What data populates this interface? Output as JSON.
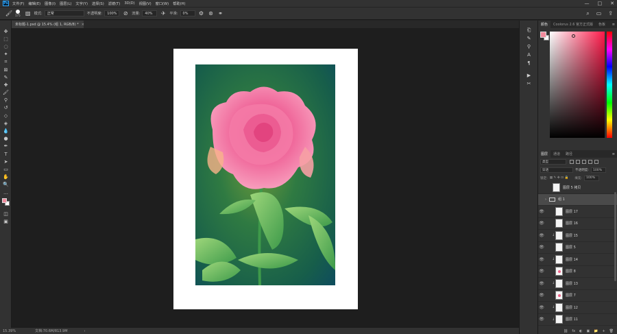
{
  "app": {
    "logo": "Ps"
  },
  "menu": [
    "文件(F)",
    "编辑(E)",
    "图像(I)",
    "图层(L)",
    "文字(Y)",
    "选择(S)",
    "滤镜(T)",
    "3D(D)",
    "视图(V)",
    "窗口(W)",
    "帮助(H)"
  ],
  "window_controls": [
    "—",
    "□",
    "✕"
  ],
  "options": {
    "brush_size": "175",
    "mode_label": "模式:",
    "mode_value": "正常",
    "opacity_label": "不透明度:",
    "opacity_value": "100%",
    "flow_label": "流量:",
    "flow_value": "40%",
    "smoothing_label": "平滑:",
    "smoothing_value": "0%"
  },
  "document": {
    "tab_title": "未标题-1.psd @ 15.4% (组 1, RGB/8) *",
    "tab_close": "×"
  },
  "status": {
    "zoom": "15.39%",
    "doc_size": "文档:70.6M/813.9M",
    "arrow": "›"
  },
  "color_panel": {
    "tabs": [
      "颜色",
      "Coolorus 2.6 官方正式版",
      "色板"
    ],
    "menu": "≡",
    "foreground": "#f08a9c",
    "background": "#ffffff"
  },
  "layers_panel": {
    "tabs": [
      "图层",
      "通道",
      "路径"
    ],
    "menu": "≡",
    "filter_kind": "类型",
    "blend_mode": "穿透",
    "opacity_label": "不透明度:",
    "opacity_value": "100%",
    "lock_label": "锁定:",
    "fill_label": "填充:",
    "fill_value": "100%",
    "layers": [
      {
        "name": "图层 5 拷贝",
        "eye": "",
        "clip": "",
        "kind": "layer",
        "selected": false,
        "dot": false
      },
      {
        "name": "组 1",
        "eye": "",
        "clip": "",
        "kind": "group",
        "selected": true,
        "dot": false
      },
      {
        "name": "图层 17",
        "eye": "👁",
        "clip": "",
        "kind": "layer",
        "selected": false,
        "dot": false
      },
      {
        "name": "图层 16",
        "eye": "👁",
        "clip": "",
        "kind": "layer",
        "selected": false,
        "dot": false
      },
      {
        "name": "图层 15",
        "eye": "👁",
        "clip": "↓",
        "kind": "layer",
        "selected": false,
        "dot": false
      },
      {
        "name": "图层 5",
        "eye": "👁",
        "clip": "",
        "kind": "layer",
        "selected": false,
        "dot": false
      },
      {
        "name": "图层 14",
        "eye": "👁",
        "clip": "↓",
        "kind": "layer",
        "selected": false,
        "dot": false
      },
      {
        "name": "图层 8",
        "eye": "👁",
        "clip": "",
        "kind": "layer",
        "selected": false,
        "dot": true
      },
      {
        "name": "图层 13",
        "eye": "👁",
        "clip": "↓",
        "kind": "layer",
        "selected": false,
        "dot": false
      },
      {
        "name": "图层 7",
        "eye": "👁",
        "clip": "",
        "kind": "layer",
        "selected": false,
        "dot": true
      },
      {
        "name": "图层 12",
        "eye": "👁",
        "clip": "↓",
        "kind": "layer",
        "selected": false,
        "dot": false
      },
      {
        "name": "图层 11",
        "eye": "👁",
        "clip": "↓",
        "kind": "layer",
        "selected": false,
        "dot": false
      }
    ],
    "footer_icons": [
      "⛓",
      "fx",
      "◐",
      "▣",
      "📁",
      "+",
      "🗑"
    ]
  },
  "tools": [
    "move-tool-icon",
    "marquee-tool-icon",
    "lasso-tool-icon",
    "magic-wand-icon",
    "crop-tool-icon",
    "frame-tool-icon",
    "eyedropper-icon",
    "healing-brush-icon",
    "brush-tool-icon",
    "clone-stamp-icon",
    "history-brush-icon",
    "eraser-icon",
    "paint-bucket-icon",
    "blur-tool-icon",
    "dodge-tool-icon",
    "pen-tool-icon",
    "type-tool-icon",
    "path-select-icon",
    "shape-tool-icon",
    "hand-tool-icon",
    "zoom-tool-icon",
    "more-tools-icon"
  ],
  "tool_glyphs": [
    "✥",
    "⬚",
    "◌",
    "✦",
    "⌗",
    "⊠",
    "✎",
    "✚",
    "🖌",
    "⚲",
    "↺",
    "◇",
    "◈",
    "💧",
    "●",
    "✒",
    "T",
    "➤",
    "▭",
    "✋",
    "🔍",
    "…"
  ]
}
